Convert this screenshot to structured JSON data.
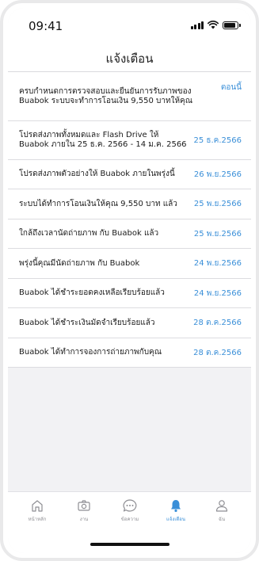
{
  "status_bar": {
    "time": "09:41"
  },
  "header": {
    "title": "แจ้งเตือน"
  },
  "notifications": [
    {
      "text": "ครบกำหนดการตรวจสอบและยืนยันการรับภาพของ Buabok ระบบจะทำการโอนเงิน 9,550 บาทให้คุณ",
      "date": "ตอนนี้"
    },
    {
      "text": "โปรดส่งภาพทั้งหมดและ Flash Drive ให้ Buabok ภายใน 25 ธ.ค. 2566 - 14 ม.ค. 2566",
      "date": "25 ธ.ค.2566"
    },
    {
      "text": "โปรดส่งภาพตัวอย่างให้ Buabok ภายในพรุ่งนี้",
      "date": "26 พ.ย.2566"
    },
    {
      "text": "ระบบได้ทำการโอนเงินให้คุณ 9,550 บาท แล้ว",
      "date": "25 พ.ย.2566"
    },
    {
      "text": "ใกล้ถึงเวลานัดถ่ายภาพ กับ Buabok  แล้ว",
      "date": "25 พ.ย.2566"
    },
    {
      "text": "พรุ่งนี้คุณมีนัดถ่ายภาพ กับ Buabok",
      "date": "24 พ.ย.2566"
    },
    {
      "text": "Buabok ได้ชำระยอดคงเหลือเรียบร้อยแล้ว",
      "date": "24 พ.ย.2566"
    },
    {
      "text": "Buabok ได้ชำระเงินมัดจำเรียบร้อยแล้ว",
      "date": "28 ต.ค.2566"
    },
    {
      "text": "Buabok ได้ทำการจองการถ่ายภาพกับคุณ",
      "date": "28 ต.ค.2566"
    }
  ],
  "tabbar": {
    "items": [
      {
        "label": "หน้าหลัก",
        "icon": "home-icon"
      },
      {
        "label": "งาน",
        "icon": "camera-icon"
      },
      {
        "label": "ข้อความ",
        "icon": "chat-icon"
      },
      {
        "label": "แจ้งเตือน",
        "icon": "bell-icon",
        "active": true
      },
      {
        "label": "ฉัน",
        "icon": "person-icon"
      }
    ]
  },
  "colors": {
    "accent": "#3a8fd8",
    "inactive": "#8e8e93",
    "background": "#f2f2f4"
  }
}
